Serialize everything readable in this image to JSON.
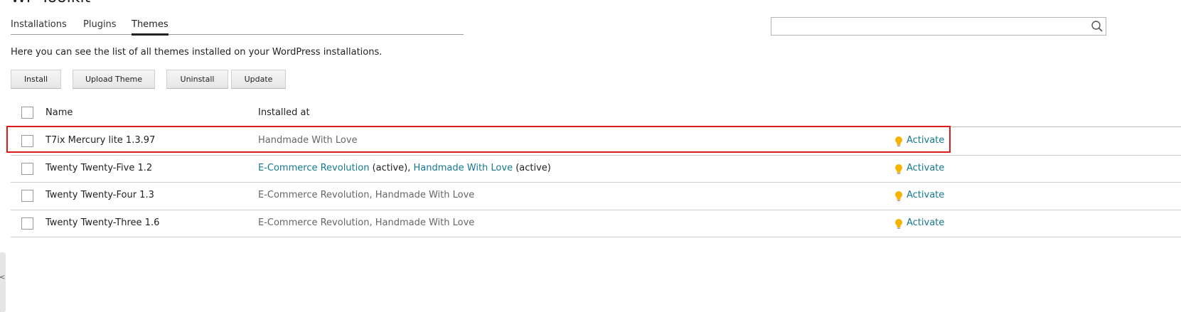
{
  "page": {
    "title": "WP Toolkit"
  },
  "tabs": [
    {
      "label": "Installations",
      "active": false
    },
    {
      "label": "Plugins",
      "active": false
    },
    {
      "label": "Themes",
      "active": true
    }
  ],
  "search": {
    "value": "",
    "placeholder": ""
  },
  "description": "Here you can see the list of all themes installed on your WordPress installations.",
  "toolbar": {
    "install": "Install",
    "upload": "Upload Theme",
    "uninstall": "Uninstall",
    "update": "Update"
  },
  "table": {
    "headers": {
      "name": "Name",
      "installed_at": "Installed at"
    },
    "rows": [
      {
        "name": "T7ix Mercury lite 1.3.97",
        "installed_at": [
          {
            "text": "Handmade With Love"
          }
        ],
        "action": "Activate"
      },
      {
        "name": "Twenty Twenty-Five 1.2",
        "installed_at": [
          {
            "text": "E-Commerce Revolution",
            "active_label": " (active)"
          },
          {
            "text": "Handmade With Love",
            "active_label": " (active)"
          }
        ],
        "action": "Activate"
      },
      {
        "name": "Twenty Twenty-Four 1.3",
        "installed_at": [
          {
            "text": "E-Commerce Revolution"
          },
          {
            "text": "Handmade With Love"
          }
        ],
        "action": "Activate"
      },
      {
        "name": "Twenty Twenty-Three 1.6",
        "installed_at": [
          {
            "text": "E-Commerce Revolution"
          },
          {
            "text": "Handmade With Love"
          }
        ],
        "action": "Activate"
      }
    ]
  },
  "separator": ", ",
  "edge_handle": {
    "glyph": "<"
  },
  "icons": {
    "search": "search-icon",
    "activate": "lightbulb-icon"
  },
  "colors": {
    "link": "#14788f",
    "highlight": "#e01a1a",
    "bulb": "#f5b400"
  }
}
